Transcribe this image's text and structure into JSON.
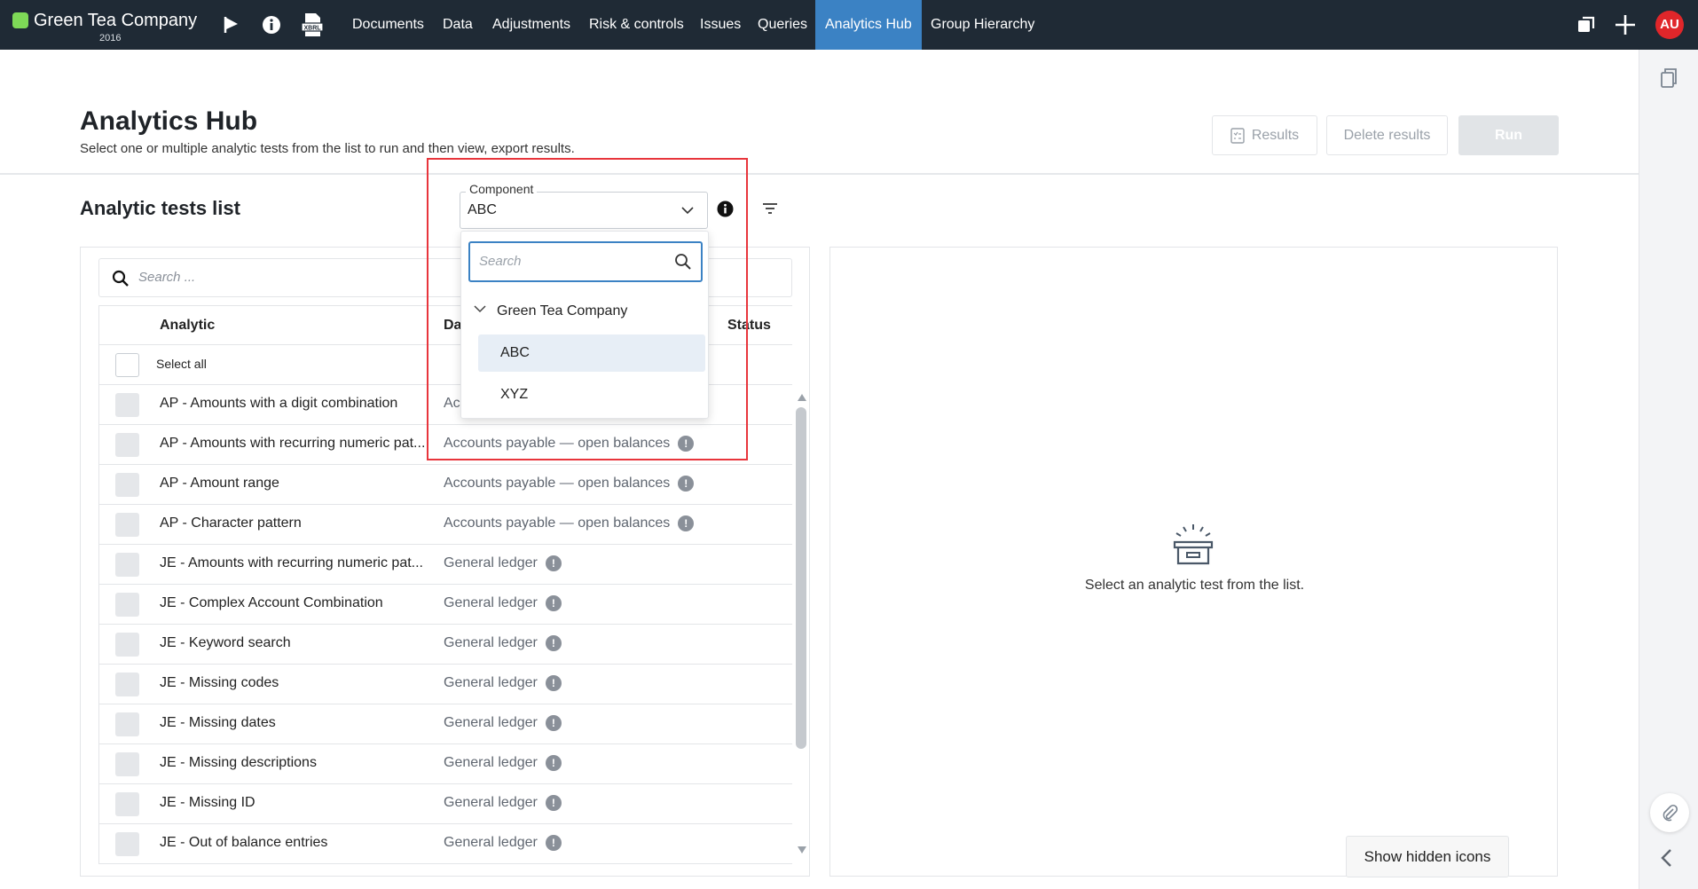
{
  "brand": {
    "name": "Green Tea Company",
    "year": "2016"
  },
  "nav": {
    "icons": [
      "flag-icon",
      "info-icon",
      "xbrl-icon"
    ],
    "items": [
      {
        "label": "Documents",
        "active": false
      },
      {
        "label": "Data",
        "active": false
      },
      {
        "label": "Adjustments",
        "active": false
      },
      {
        "label": "Risk & controls",
        "active": false
      },
      {
        "label": "Issues",
        "active": false
      },
      {
        "label": "Queries",
        "active": false
      },
      {
        "label": "Analytics Hub",
        "active": true
      },
      {
        "label": "Group Hierarchy",
        "active": false
      }
    ],
    "right_icons": [
      "windows-icon",
      "plus-icon"
    ],
    "avatar": "AU"
  },
  "page": {
    "title": "Analytics Hub",
    "subtitle": "Select one or multiple analytic tests from the list to run and then view, export results.",
    "buttons": {
      "results": "Results",
      "delete_results": "Delete results",
      "run": "Run"
    }
  },
  "section": {
    "title": "Analytic tests list"
  },
  "component": {
    "label": "Component",
    "value": "ABC"
  },
  "list": {
    "search_placeholder": "Search ...",
    "columns": {
      "analytic": "Analytic",
      "data": "Da",
      "status": "Status"
    },
    "select_all": "Select all",
    "rows": [
      {
        "name": "AP - Amounts with a digit combination",
        "data": "Ac"
      },
      {
        "name": "AP - Amounts with recurring numeric pat...",
        "data": "Accounts payable — open balances"
      },
      {
        "name": "AP - Amount range",
        "data": "Accounts payable — open balances"
      },
      {
        "name": "AP - Character pattern",
        "data": "Accounts payable — open balances"
      },
      {
        "name": "JE - Amounts with recurring numeric pat...",
        "data": "General ledger"
      },
      {
        "name": "JE - Complex Account Combination",
        "data": "General ledger"
      },
      {
        "name": "JE - Keyword search",
        "data": "General ledger"
      },
      {
        "name": "JE - Missing codes",
        "data": "General ledger"
      },
      {
        "name": "JE - Missing dates",
        "data": "General ledger"
      },
      {
        "name": "JE - Missing descriptions",
        "data": "General ledger"
      },
      {
        "name": "JE - Missing ID",
        "data": "General ledger"
      },
      {
        "name": "JE - Out of balance entries",
        "data": "General ledger"
      }
    ],
    "alert_glyph": "!"
  },
  "dropdown": {
    "search_placeholder": "Search",
    "group": "Green Tea Company",
    "options": [
      {
        "label": "ABC",
        "selected": true
      },
      {
        "label": "XYZ",
        "selected": false
      }
    ]
  },
  "results": {
    "empty_text": "Select an analytic test from the list."
  },
  "tooltip": {
    "label": "Show hidden icons"
  },
  "colors": {
    "nav_bg": "#1f2a35",
    "accent": "#3b82c4",
    "avatar": "#e0262a",
    "highlight": "#e8353c"
  }
}
